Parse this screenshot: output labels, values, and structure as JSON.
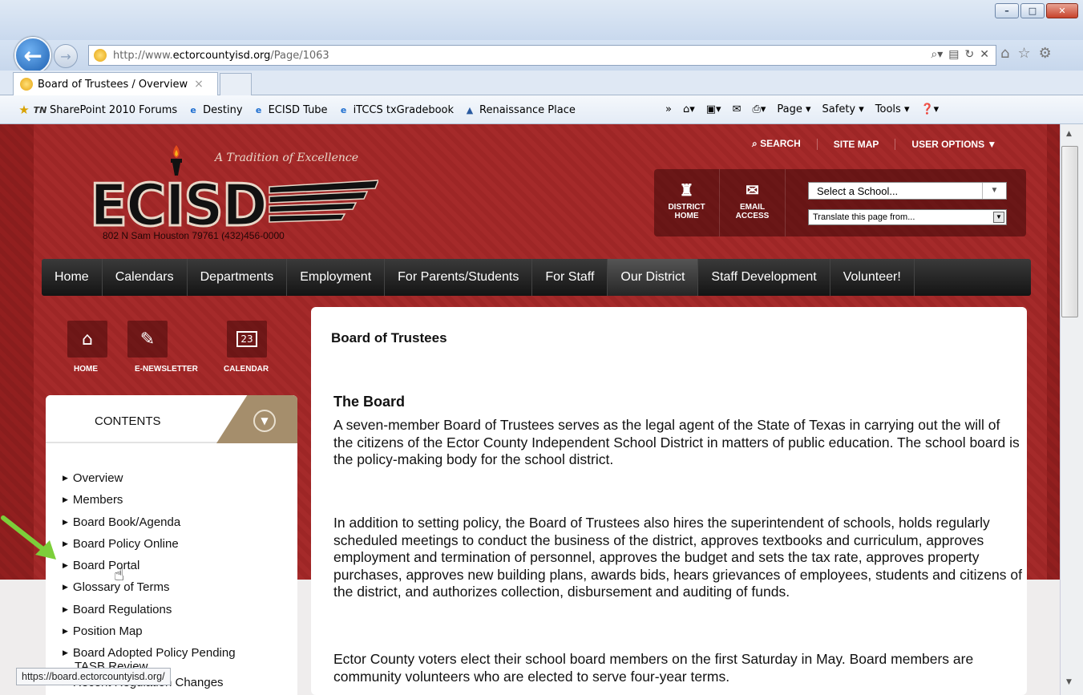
{
  "browser": {
    "url_prefix": "http://www.",
    "url_domain": "ectorcountyisd.org",
    "url_path": "/Page/1063",
    "tab_title": "Board of Trustees / Overview",
    "tab_close": "×",
    "window_controls": [
      "–",
      "□",
      "✕"
    ],
    "favorites": [
      {
        "label": "SharePoint 2010 Forums",
        "icon": "tn-icon"
      },
      {
        "label": "Destiny",
        "icon": "ie-page-icon"
      },
      {
        "label": "ECISD Tube",
        "icon": "ie-page-icon"
      },
      {
        "label": "iTCCS txGradebook",
        "icon": "ie-page-icon"
      },
      {
        "label": "Renaissance Place",
        "icon": "renaissance-icon"
      }
    ],
    "command_bar": {
      "page": "Page ▾",
      "safety": "Safety ▾",
      "tools": "Tools ▾"
    },
    "status_url": "https://board.ectorcountyisd.org/"
  },
  "site": {
    "tagline": "A Tradition of Excellence",
    "logo_text": "ECISD",
    "address": "802 N Sam Houston 79761 (432)456-0000",
    "utility_nav": {
      "search": "SEARCH",
      "site_map": "SITE MAP",
      "user_options": "USER OPTIONS ▼"
    },
    "quick_links": {
      "district_home_1": "DISTRICT",
      "district_home_2": "HOME",
      "email_1": "EMAIL",
      "email_2": "ACCESS"
    },
    "school_select": "Select a School...",
    "translate_select": "Translate this page from...",
    "main_nav": [
      "Home",
      "Calendars",
      "Departments",
      "Employment",
      "For Parents/Students",
      "For Staff",
      "Our District",
      "Staff Development",
      "Volunteer!"
    ],
    "left_icons": {
      "home": "HOME",
      "enewsletter": "E-NEWSLETTER",
      "calendar": "CALENDAR",
      "calendar_day": "23"
    },
    "contents_title": "CONTENTS",
    "contents_items": [
      "Overview",
      "Members",
      "Board Book/Agenda",
      "Board Policy Online",
      "Board Portal",
      "Glossary of Terms",
      "Board Regulations",
      "Position Map",
      "Board Adopted Policy Pending",
      "TASB Review",
      "Recent Regulation Changes"
    ],
    "page_title": "Board of Trustees",
    "section_heading": "The Board",
    "paragraphs": [
      "A seven-member Board of Trustees serves as the legal agent of the State of Texas in carrying out the will of the citizens of the Ector County Independent School District in matters of public education. The school board is the policy-making body for the school district.",
      "In addition to setting policy, the Board of Trustees also hires the superintendent of schools, holds regularly scheduled meetings to conduct the business of the district, approves textbooks and curriculum, approves employment and termination of personnel, approves the budget and sets the tax rate, approves property purchases, approves new building plans, awards bids, hears grievances of employees, students and citizens of the district, and authorizes collection, disbursement and auditing of funds.",
      "Ector County voters elect their school board members on the first Saturday in May. Board members are community volunteers who are elected to serve four-year terms."
    ]
  },
  "colors": {
    "brand_red": "#a52a2a",
    "nav_black": "#141414",
    "tan_accent": "#a58e6c",
    "annotation_arrow": "#7ccf3a"
  }
}
